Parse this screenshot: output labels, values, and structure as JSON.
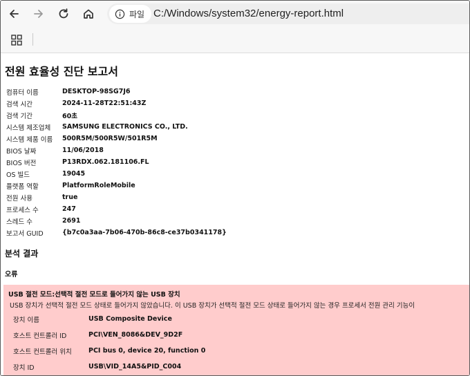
{
  "browser": {
    "back_icon": "arrow-left-icon",
    "forward_icon": "arrow-right-icon",
    "reload_icon": "reload-icon",
    "home_icon": "home-icon",
    "site_info_label": "파일",
    "url": "C:/Windows/system32/energy-report.html",
    "apps_icon": "apps-grid-icon"
  },
  "report": {
    "title": "전원 효율성 진단 보고서",
    "info": [
      {
        "key": "컴퓨터 이름",
        "value": "DESKTOP-98SG7J6"
      },
      {
        "key": "검색 시간",
        "value": "2024-11-28T22:51:43Z"
      },
      {
        "key": "검색 기간",
        "value": "60초"
      },
      {
        "key": "시스템 제조업체",
        "value": "SAMSUNG ELECTRONICS CO., LTD."
      },
      {
        "key": "시스템 제품 이름",
        "value": "500R5M/500R5W/501R5M"
      },
      {
        "key": "BIOS 날짜",
        "value": "11/06/2018"
      },
      {
        "key": "BIOS 버전",
        "value": "P13RDX.062.181106.FL"
      },
      {
        "key": "OS 빌드",
        "value": "19045"
      },
      {
        "key": "플랫폼 역할",
        "value": "PlatformRoleMobile"
      },
      {
        "key": "전원 사용",
        "value": "true"
      },
      {
        "key": "프로세스 수",
        "value": "247"
      },
      {
        "key": "스레드 수",
        "value": "2691"
      },
      {
        "key": "보고서 GUID",
        "value": "{b7c0a3aa-7b06-470b-86c8-ce37b0341178}"
      }
    ],
    "analysis_heading": "분석 결과",
    "errors_heading": "오류",
    "error": {
      "title": "USB 절전 모드:선택적 절전 모드로 들어가지 않는 USB 장치",
      "description": "USB 장치가 선택적 절전 모드 상태로 들어가지 않았습니다. 이 USB 장치가 선택적 절전 모드 상태로 들어가지 않는 경우 프로세서 전원 관리 기능이",
      "details": [
        {
          "key": "장치 이름",
          "value": "USB Composite Device"
        },
        {
          "key": "호스트 컨트롤러 ID",
          "value": "PCI\\VEN_8086&DEV_9D2F"
        },
        {
          "key": "호스트 컨트롤러 위치",
          "value": "PCI bus 0, device 20, function 0"
        },
        {
          "key": "장치 ID",
          "value": "USB\\VID_14A5&PID_C004"
        }
      ],
      "background_color": "#ffcccc"
    }
  }
}
